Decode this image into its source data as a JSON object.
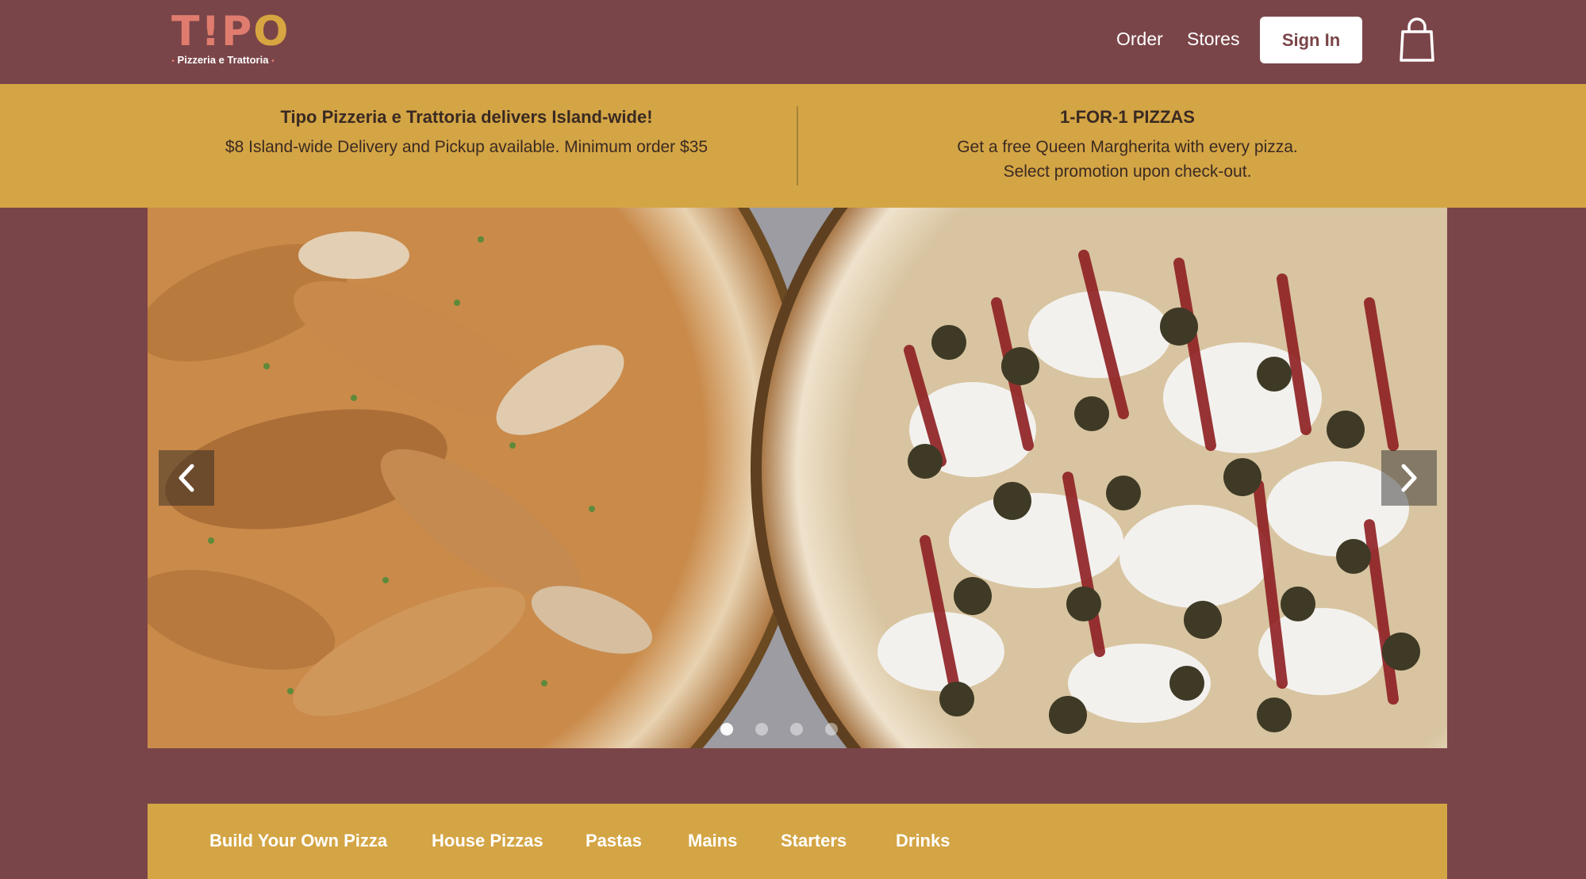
{
  "brand": {
    "logo_word_1": "T!P",
    "logo_word_2": "O",
    "logo_sub": "Pizzeria e Trattoria",
    "logo_dot": "•",
    "primary_color": "#7a4549",
    "accent_color": "#d4a545"
  },
  "nav": {
    "order_label": "Order",
    "stores_label": "Stores",
    "signin_label": "Sign In",
    "cart_icon": "shopping-bag-icon"
  },
  "promo": {
    "left_title": "Tipo Pizzeria e Trattoria delivers Island-wide!",
    "left_text": "$8 Island-wide Delivery and Pickup available. Minimum order $35",
    "right_title": "1-FOR-1 PIZZAS",
    "right_text_1": "Get a free Queen Margherita with every pizza.",
    "right_text_2": "Select promotion upon check-out."
  },
  "carousel": {
    "prev_icon": "chevron-left-icon",
    "next_icon": "chevron-right-icon",
    "slide_count": 4,
    "active_slide": 1
  },
  "categories": [
    "Build Your Own Pizza",
    "House Pizzas",
    "Pastas",
    "Mains",
    "Starters",
    "Drinks"
  ]
}
